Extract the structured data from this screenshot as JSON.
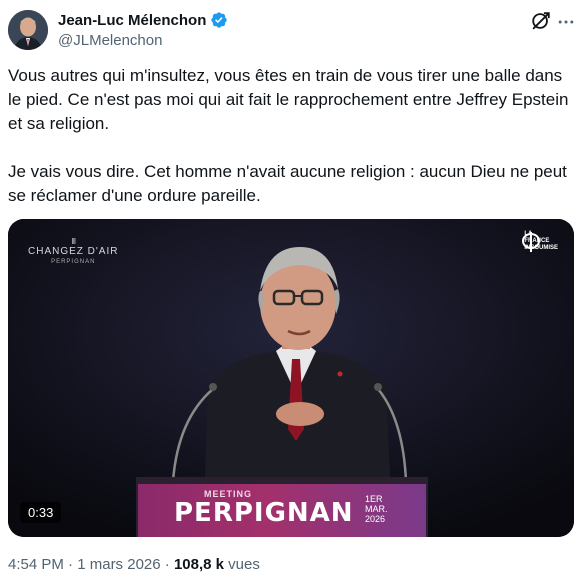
{
  "author": {
    "display_name": "Jean-Luc Mélenchon",
    "handle": "@JLMelenchon",
    "verified": true,
    "verified_color": "#1d9bf0"
  },
  "icons": {
    "grok": "grok-icon",
    "more": "more-icon",
    "verified": "verified-badge-icon"
  },
  "tweet": {
    "paragraph_1": "Vous autres qui m'insultez, vous êtes en train de vous tirer une balle dans le pied. Ce n'est pas moi qui ait fait le rapprochement entre Jeffrey Epstein et sa religion.",
    "paragraph_2": "Je vais vous dire. Cet homme n'avait aucune religion : aucun Dieu ne peut se réclamer d'une ordure pareille."
  },
  "media": {
    "duration": "0:33",
    "event_logo_line1": "CHANGEZ D'AIR",
    "event_logo_line2": "PERPIGNAN",
    "party_logo_text_1": "LA",
    "party_logo_text_2": "FRANCE",
    "party_logo_text_3": "INSOUMISE",
    "banner_top": "MEETING",
    "banner_city": "PERPIGNAN",
    "banner_date_1": "1ER",
    "banner_date_2": "MAR.",
    "banner_date_3": "2026"
  },
  "meta": {
    "time": "4:54 PM",
    "separator": " · ",
    "date": "1 mars 2026",
    "views_count": "108,8 k",
    "views_label": " vues"
  }
}
